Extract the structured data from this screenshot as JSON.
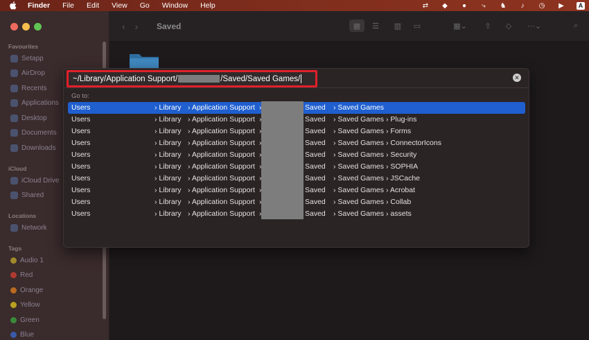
{
  "menubar": {
    "items": [
      {
        "label": "Finder",
        "bold": true
      },
      {
        "label": "File"
      },
      {
        "label": "Edit"
      },
      {
        "label": "View"
      },
      {
        "label": "Go"
      },
      {
        "label": "Window"
      },
      {
        "label": "Help"
      }
    ],
    "status_icons": [
      "sync-icon",
      "dropbox-icon",
      "chrome-icon",
      "script-icon",
      "monkey-icon",
      "bell-icon",
      "clock-icon",
      "play-icon",
      "input-source-icon"
    ],
    "input_source_label": "A"
  },
  "finder": {
    "title": "Saved",
    "sidebar": {
      "sections": [
        {
          "title": "Favourites",
          "items": [
            "Setapp",
            "AirDrop",
            "Recents",
            "Applications",
            "Desktop",
            "Documents",
            "Downloads"
          ]
        },
        {
          "title": "iCloud",
          "items": [
            "iCloud Drive",
            "Shared"
          ]
        },
        {
          "title": "Locations",
          "items": [
            "Network"
          ]
        },
        {
          "title": "Tags",
          "items": [
            "Audio 1",
            "Red",
            "Orange",
            "Yellow",
            "Green",
            "Blue"
          ]
        }
      ],
      "tag_colors": {
        "Audio 1": "#a08a2a",
        "Red": "#b03a30",
        "Orange": "#b86a20",
        "Yellow": "#b8a020",
        "Green": "#3a8a3a",
        "Blue": "#3a5aa8"
      }
    }
  },
  "goto": {
    "path_prefix": "~/Library/Application Support/",
    "path_suffix": "/Saved/Saved Games/",
    "label": "Go to:",
    "rows": [
      {
        "users": "Users",
        "library": "› Library",
        "app": "› Application Support",
        "gap": "›",
        "saved": "Saved",
        "games": "› Saved Games",
        "last": ""
      },
      {
        "users": "Users",
        "library": "› Library",
        "app": "› Application Support",
        "gap": "›",
        "saved": "Saved",
        "games": "› Saved Games",
        "last": "› Plug-ins"
      },
      {
        "users": "Users",
        "library": "› Library",
        "app": "› Application Support",
        "gap": "›",
        "saved": "Saved",
        "games": "› Saved Games",
        "last": "› Forms"
      },
      {
        "users": "Users",
        "library": "› Library",
        "app": "› Application Support",
        "gap": "›",
        "saved": "Saved",
        "games": "› Saved Games",
        "last": "› ConnectorIcons"
      },
      {
        "users": "Users",
        "library": "› Library",
        "app": "› Application Support",
        "gap": "›",
        "saved": "Saved",
        "games": "› Saved Games",
        "last": "› Security"
      },
      {
        "users": "Users",
        "library": "› Library",
        "app": "› Application Support",
        "gap": "›",
        "saved": "Saved",
        "games": "› Saved Games",
        "last": "› SOPHIA"
      },
      {
        "users": "Users",
        "library": "› Library",
        "app": "› Application Support",
        "gap": "›",
        "saved": "Saved",
        "games": "› Saved Games",
        "last": "› JSCache"
      },
      {
        "users": "Users",
        "library": "› Library",
        "app": "› Application Support",
        "gap": "›",
        "saved": "Saved",
        "games": "› Saved Games",
        "last": "› Acrobat"
      },
      {
        "users": "Users",
        "library": "› Library",
        "app": "› Application Support",
        "gap": "›",
        "saved": "Saved",
        "games": "› Saved Games",
        "last": "› Collab"
      },
      {
        "users": "Users",
        "library": "› Library",
        "app": "› Application Support",
        "gap": "›",
        "saved": "Saved",
        "games": "› Saved Games",
        "last": "› assets"
      }
    ],
    "selected_row": 0
  }
}
